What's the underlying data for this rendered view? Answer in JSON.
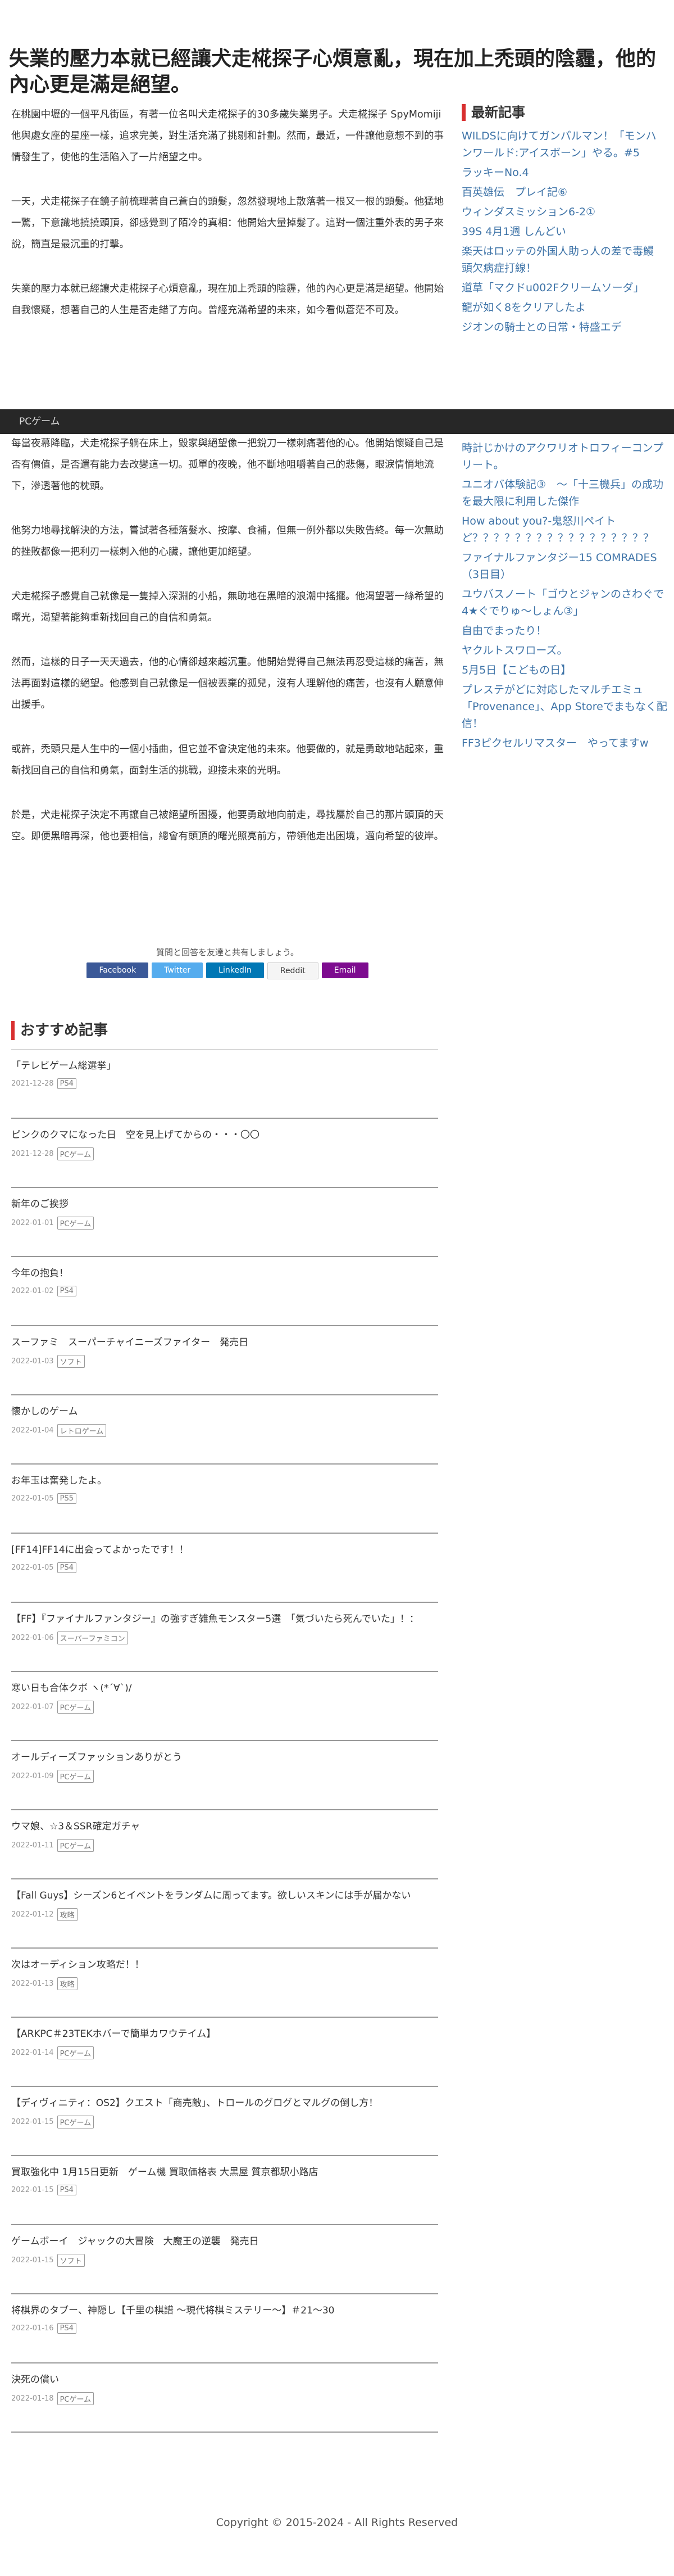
{
  "article": {
    "title": "失業的壓力本就已經讓犬走椛探子心煩意亂，現在加上禿頭的陰霾，他的內心更是滿是絕望。",
    "paragraphs": [
      "在桃園中壢的一個平凡街區，有著一位名叫犬走椛探子的30多歲失業男子。犬走椛探子 SpyMomiji他與處女座的星座一樣，追求完美，對生活充滿了挑剔和計劃。然而，最近，一件讓他意想不到的事情發生了，使他的生活陷入了一片絕望之中。",
      "一天，犬走椛探子在鏡子前梳理著自己蒼白的頭髮，忽然發現地上散落著一根又一根的頭髮。他猛地一驚，下意識地撓撓頭頂，卻感覺到了陌冷的真相：他開始大量掉髮了。這對一個注重外表的男子來說，簡直是最沉重的打擊。",
      "失業的壓力本就已經讓犬走椛探子心煩意亂，現在加上禿頭的陰霾，他的內心更是滿是絕望。他開始自我懷疑，想著自己的人生是否走錯了方向。曾經充滿希望的未來，如今看似蒼茫不可及。"
    ],
    "lower_paragraphs": [
      "每當夜幕降臨，犬走椛探子躺在床上，毀家與絕望像一把銳刀一樣刺痛著他的心。他開始懷疑自己是否有價值，是否還有能力去改變這一切。孤單的夜晚，他不斷地咀嚼著自己的悲傷，眼淚情悄地流下，滲透著他的枕頭。",
      "他努力地尋找解決的方法，嘗試著各種落髮水、按摩、食補，但無一例外都以失敗告終。每一次無助的挫敗都像一把利刃一樣刺入他的心臟，讓他更加絕望。",
      "犬走椛探子感覺自己就像是一隻掉入深淵的小船，無助地在黑暗的浪潮中搖擺。他渴望著一絲希望的曙光，渴望著能夠重新找回自己的自信和勇氣。",
      "然而，這樣的日子一天天過去，他的心情卻越來越沉重。他開始覺得自己無法再忍受這樣的痛苦，無法再面對這樣的絕望。他感到自己就像是一個被丟棄的孤兒，沒有人理解他的痛苦，也沒有人願意伸出援手。",
      "或許，禿頭只是人生中的一個小插曲，但它並不會決定他的未來。他要做的，就是勇敢地站起來，重新找回自己的自信和勇氣，面對生活的挑戰，迎接未來的光明。",
      "於是，犬走椛探子決定不再讓自己被絕望所困擾，他要勇敢地向前走，尋找屬於自己的那片頭頂的天空。即便黑暗再深，他也要相信，總會有頭頂的曙光照亮前方，帶領他走出困境，邁向希望的彼岸。"
    ]
  },
  "sidebar": {
    "heading": "最新記事",
    "items": [
      "WILDSに向けてガンパルマン！「モンハンワールド:アイスボーン」やる。#5",
      "ラッキーNo.4",
      "百英雄伝　プレイ記⑥",
      "ウィンダスミッション6-2①",
      "39S 4月1週 しんどい",
      "楽天はロッテの外国人助っ人の差で毒鰻頭欠病症打線！",
      "道草「マクドu002Fクリームソーダ」",
      "龍が如く8をクリアしたよ",
      "ジオンの騎士との日常・特盛エデ"
    ],
    "lower_items": [
      "時計じかけのアクワリオトロフィーコンプリート。",
      "ユニオバ体験記③　〜「十三機兵」の成功を最大限に利用した傑作",
      "How about you?-鬼怒川ペイトど？？？？？？？？？？？？？？？？？",
      "ファイナルファンタジー15 COMRADES（3日目）",
      "ユウバスノート「ゴウとジャンのさわぐで4★ぐでりゅ〜しょん③」",
      "自由でまったり！",
      "ヤクルトスワローズ。",
      "5月5日【こどもの日】",
      "プレステがどに対応したマルチエミュ「Provenance」、App Storeでまもなく配信！",
      "FF3ピクセルリマスター　やってますw"
    ]
  },
  "bar": {
    "label": "PCゲーム"
  },
  "share": {
    "text": "質問と回答を友達と共有しましょう。",
    "buttons": [
      {
        "label": "Facebook",
        "color": "#3b5998"
      },
      {
        "label": "Twitter",
        "color": "#55acee"
      },
      {
        "label": "LinkedIn",
        "color": "#0077b5"
      },
      {
        "label": "Reddit",
        "color": "#f5f5f5"
      },
      {
        "label": "Email",
        "color": "#7d0b8f"
      }
    ]
  },
  "recommended": {
    "title": "おすすめ記事",
    "items": [
      {
        "title": "「テレビゲーム総選挙」",
        "date": "2021-12-28",
        "category": "PS4"
      },
      {
        "title": "ピンクのクマになった日　空を見上げてからの・・・〇〇",
        "date": "2021-12-28",
        "category": "PCゲーム"
      },
      {
        "title": "新年のご挨拶",
        "date": "2022-01-01",
        "category": "PCゲーム"
      },
      {
        "title": "今年の抱負！",
        "date": "2022-01-02",
        "category": "PS4"
      },
      {
        "title": "スーファミ　スーパーチャイニーズファイター　発売日",
        "date": "2022-01-03",
        "category": "ソフト"
      },
      {
        "title": "懐かしのゲーム",
        "date": "2022-01-04",
        "category": "レトロゲーム"
      },
      {
        "title": "お年玉は奮発したよ。",
        "date": "2022-01-05",
        "category": "PS5"
      },
      {
        "title": "[FF14]FF14に出会ってよかったです！！",
        "date": "2022-01-05",
        "category": "PS4"
      },
      {
        "title": "【FF】『ファイナルファンタジー』の強すぎ雑魚モンスター5選　「気づいたら死んでいた」！：",
        "date": "2022-01-06",
        "category": "スーパーファミコン"
      },
      {
        "title": "寒い日も合体クボ ヽ(*´∀`)/",
        "date": "2022-01-07",
        "category": "PCゲーム"
      },
      {
        "title": "オールディーズファッションありがとう",
        "date": "2022-01-09",
        "category": "PCゲーム"
      },
      {
        "title": "ウマ娘、☆3＆SSR確定ガチャ",
        "date": "2022-01-11",
        "category": "PCゲーム"
      },
      {
        "title": "【Fall Guys】シーズン6とイベントをランダムに周ってます。欲しいスキンには手が届かない",
        "date": "2022-01-12",
        "category": "攻略"
      },
      {
        "title": "次はオーディション攻略だ！！",
        "date": "2022-01-13",
        "category": "攻略"
      },
      {
        "title": "【ARKPC＃23TEKホバーで簡単カワウテイム】",
        "date": "2022-01-14",
        "category": "PCゲーム"
      },
      {
        "title": "【ディヴィニティ：OS2】クエスト「商売敵」、トロールのグログとマルグの倒し方！",
        "date": "2022-01-15",
        "category": "PCゲーム"
      },
      {
        "title": "買取強化中 1月15日更新　ゲーム機 買取価格表 大黒屋 質京都駅小路店",
        "date": "2022-01-15",
        "category": "PS4"
      },
      {
        "title": "ゲームボーイ　ジャックの大冒険　大魔王の逆襲　発売日",
        "date": "2022-01-15",
        "category": "ソフト"
      },
      {
        "title": "将棋界のタブー、神隠し【千里の棋譜 ～現代将棋ミステリー～】＃21～30",
        "date": "2022-01-16",
        "category": "PS4"
      },
      {
        "title": "決死の償い",
        "date": "2022-01-18",
        "category": "PCゲーム"
      }
    ]
  },
  "footer": {
    "copyright": "Copyright © 2015-2024 - All Rights Reserved"
  }
}
